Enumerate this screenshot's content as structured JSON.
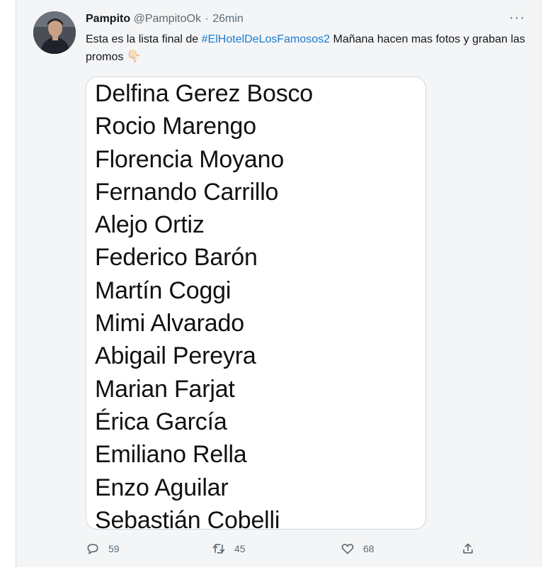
{
  "tweet": {
    "author_name": "Pampito",
    "author_handle": "@PampitoOk",
    "separator": "·",
    "time": "26min",
    "more_icon": "more-horizontal-icon",
    "text_before": "Esta es la lista final de ",
    "hashtag": "#ElHotelDeLosFamosos2",
    "text_after": " Mañana hacen mas fotos y graban las promos ",
    "emoji": "👇🏻",
    "image_names": [
      "Delfina Gerez Bosco",
      "Rocio Marengo",
      "Florencia Moyano",
      "Fernando Carrillo",
      "Alejo Ortiz",
      "Federico Barón",
      "Martín Coggi",
      "Mimi Alvarado",
      "Abigail Pereyra",
      "Marian Farjat",
      "Érica García",
      "Emiliano Rella",
      "Enzo Aguilar",
      "Sebastián Cobelli"
    ],
    "actions": {
      "reply_count": "59",
      "retweet_count": "45",
      "like_count": "68"
    }
  },
  "colors": {
    "hashtag": "#1b7bd1",
    "secondary_text": "#5b6b78",
    "background": "#f4f5f6"
  }
}
